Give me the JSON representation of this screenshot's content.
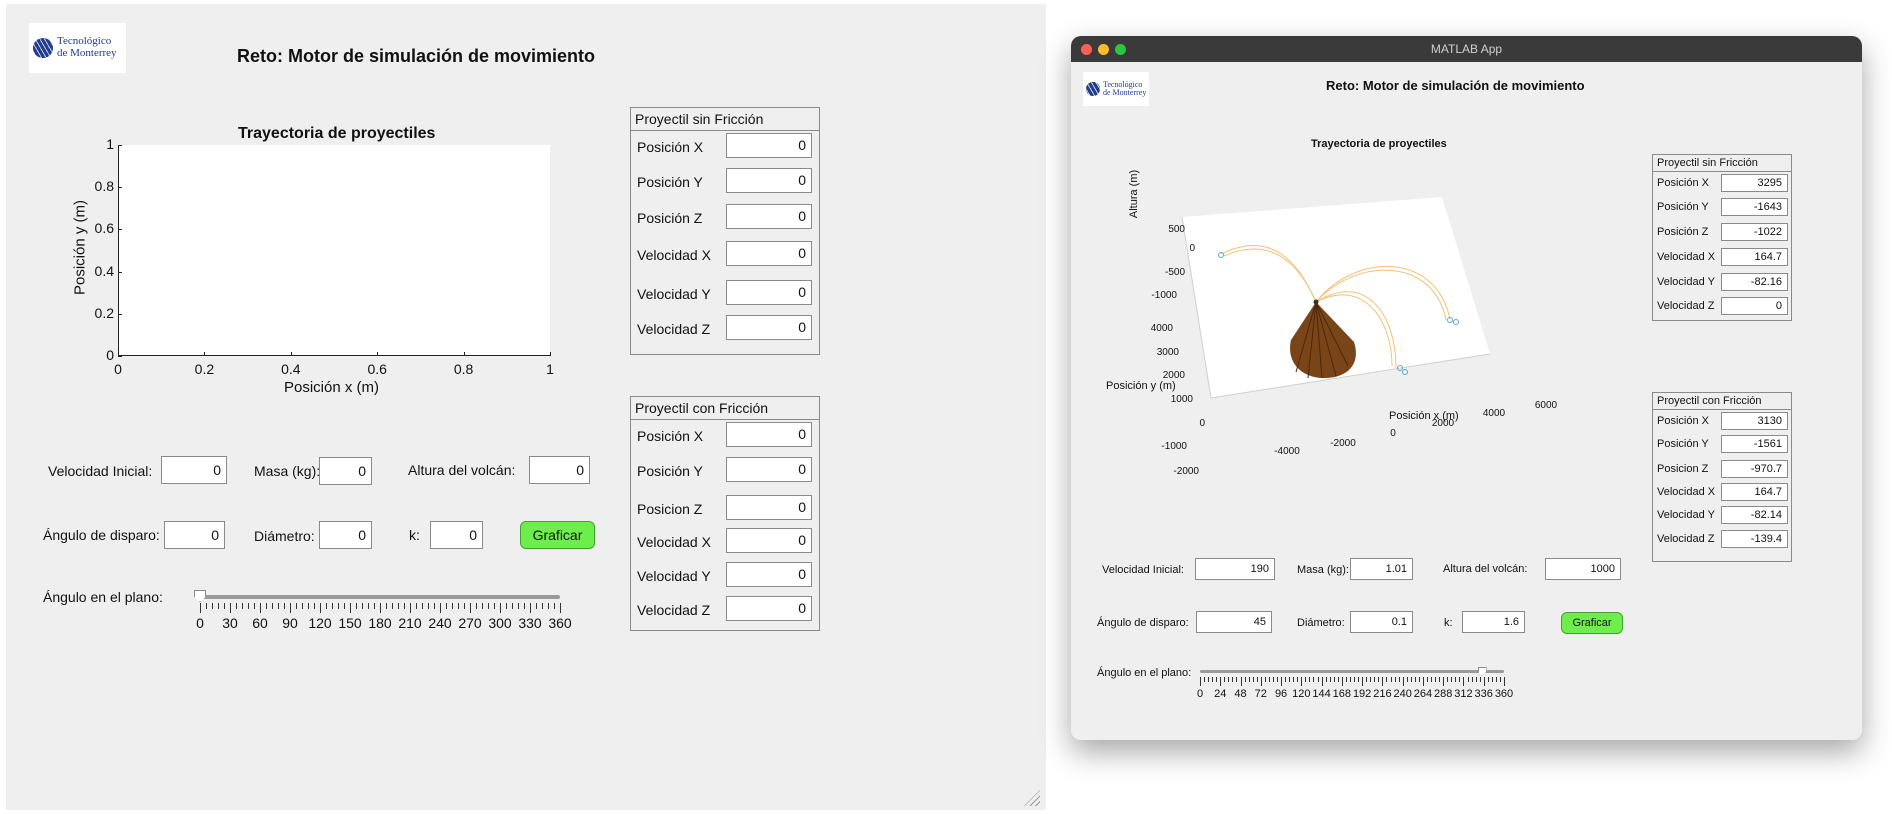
{
  "logo": {
    "line1": "Tecnológico",
    "line2": "de Monterrey"
  },
  "app_title": "Reto: Motor de simulación de movimiento",
  "plot": {
    "title": "Trayectoria de proyectiles",
    "xlabel": "Posición x (m)",
    "ylabel": "Posición y (m)",
    "xticks": [
      "0",
      "0.2",
      "0.4",
      "0.6",
      "0.8",
      "1"
    ],
    "yticks": [
      "0",
      "0.2",
      "0.4",
      "0.6",
      "0.8",
      "1"
    ]
  },
  "panel_sin": {
    "title": "Proyectil sin Fricción",
    "rows": [
      {
        "label": "Posición X",
        "value": "0"
      },
      {
        "label": "Posición Y",
        "value": "0"
      },
      {
        "label": "Posición Z",
        "value": "0"
      },
      {
        "label": "Velocidad X",
        "value": "0"
      },
      {
        "label": "Velocidad Y",
        "value": "0"
      },
      {
        "label": "Velocidad Z",
        "value": "0"
      }
    ]
  },
  "panel_con": {
    "title": "Proyectil con Fricción",
    "rows": [
      {
        "label": "Posición X",
        "value": "0"
      },
      {
        "label": "Posición Y",
        "value": "0"
      },
      {
        "label": "Posicion Z",
        "value": "0"
      },
      {
        "label": "Velocidad X",
        "value": "0"
      },
      {
        "label": "Velocidad Y",
        "value": "0"
      },
      {
        "label": "Velocidad Z",
        "value": "0"
      }
    ]
  },
  "inputs": {
    "vel_label": "Velocidad Inicial:",
    "vel_value": "0",
    "masa_label": "Masa (kg):",
    "masa_value": "0",
    "altura_label": "Altura del volcán:",
    "altura_value": "0",
    "angulo_label": "Ángulo de disparo:",
    "angulo_value": "0",
    "diam_label": "Diámetro:",
    "diam_value": "0",
    "k_label": "k:",
    "k_value": "0",
    "graficar": "Graficar",
    "plano_label": "Ángulo en el plano:",
    "slider_value": 0,
    "slider_ticks": [
      "0",
      "30",
      "60",
      "90",
      "120",
      "150",
      "180",
      "210",
      "240",
      "270",
      "300",
      "330",
      "360"
    ]
  },
  "right_window": {
    "window_title": "MATLAB App",
    "plot": {
      "title": "Trayectoria de proyectiles",
      "zlabel": "Altura (m)",
      "xlabel": "Posición x (m)",
      "ylabel": "Posición y (m)",
      "zticks": [
        "500",
        "0",
        "-500",
        "-1000"
      ],
      "yticks": [
        "4000",
        "3000",
        "2000",
        "1000",
        "0",
        "-1000",
        "-2000"
      ],
      "xticks": [
        "-4000",
        "-2000",
        "0",
        "2000",
        "4000",
        "6000"
      ]
    },
    "panel_sin": {
      "title": "Proyectil sin Fricción",
      "rows": [
        {
          "label": "Posición X",
          "value": "3295"
        },
        {
          "label": "Posición Y",
          "value": "-1643"
        },
        {
          "label": "Posición Z",
          "value": "-1022"
        },
        {
          "label": "Velocidad X",
          "value": "164.7"
        },
        {
          "label": "Velocidad Y",
          "value": "-82.16"
        },
        {
          "label": "Velocidad Z",
          "value": "0"
        }
      ]
    },
    "panel_con": {
      "title": "Proyectil con Fricción",
      "rows": [
        {
          "label": "Posición X",
          "value": "3130"
        },
        {
          "label": "Posición Y",
          "value": "-1561"
        },
        {
          "label": "Posicion Z",
          "value": "-970.7"
        },
        {
          "label": "Velocidad X",
          "value": "164.7"
        },
        {
          "label": "Velocidad Y",
          "value": "-82.14"
        },
        {
          "label": "Velocidad Z",
          "value": "-139.4"
        }
      ]
    },
    "inputs": {
      "vel_label": "Velocidad Inicial:",
      "vel_value": "190",
      "masa_label": "Masa (kg):",
      "masa_value": "1.01",
      "altura_label": "Altura del volcán:",
      "altura_value": "1000",
      "angulo_label": "Ángulo de disparo:",
      "angulo_value": "45",
      "diam_label": "Diámetro:",
      "diam_value": "0.1",
      "k_label": "k:",
      "k_value": "1.6",
      "graficar": "Graficar",
      "plano_label": "Ángulo en el plano:",
      "slider_value": 334,
      "slider_ticks": [
        "0",
        "24",
        "48",
        "72",
        "96",
        "120",
        "144",
        "168",
        "192",
        "216",
        "240",
        "264",
        "288",
        "312",
        "336",
        "360"
      ]
    }
  }
}
